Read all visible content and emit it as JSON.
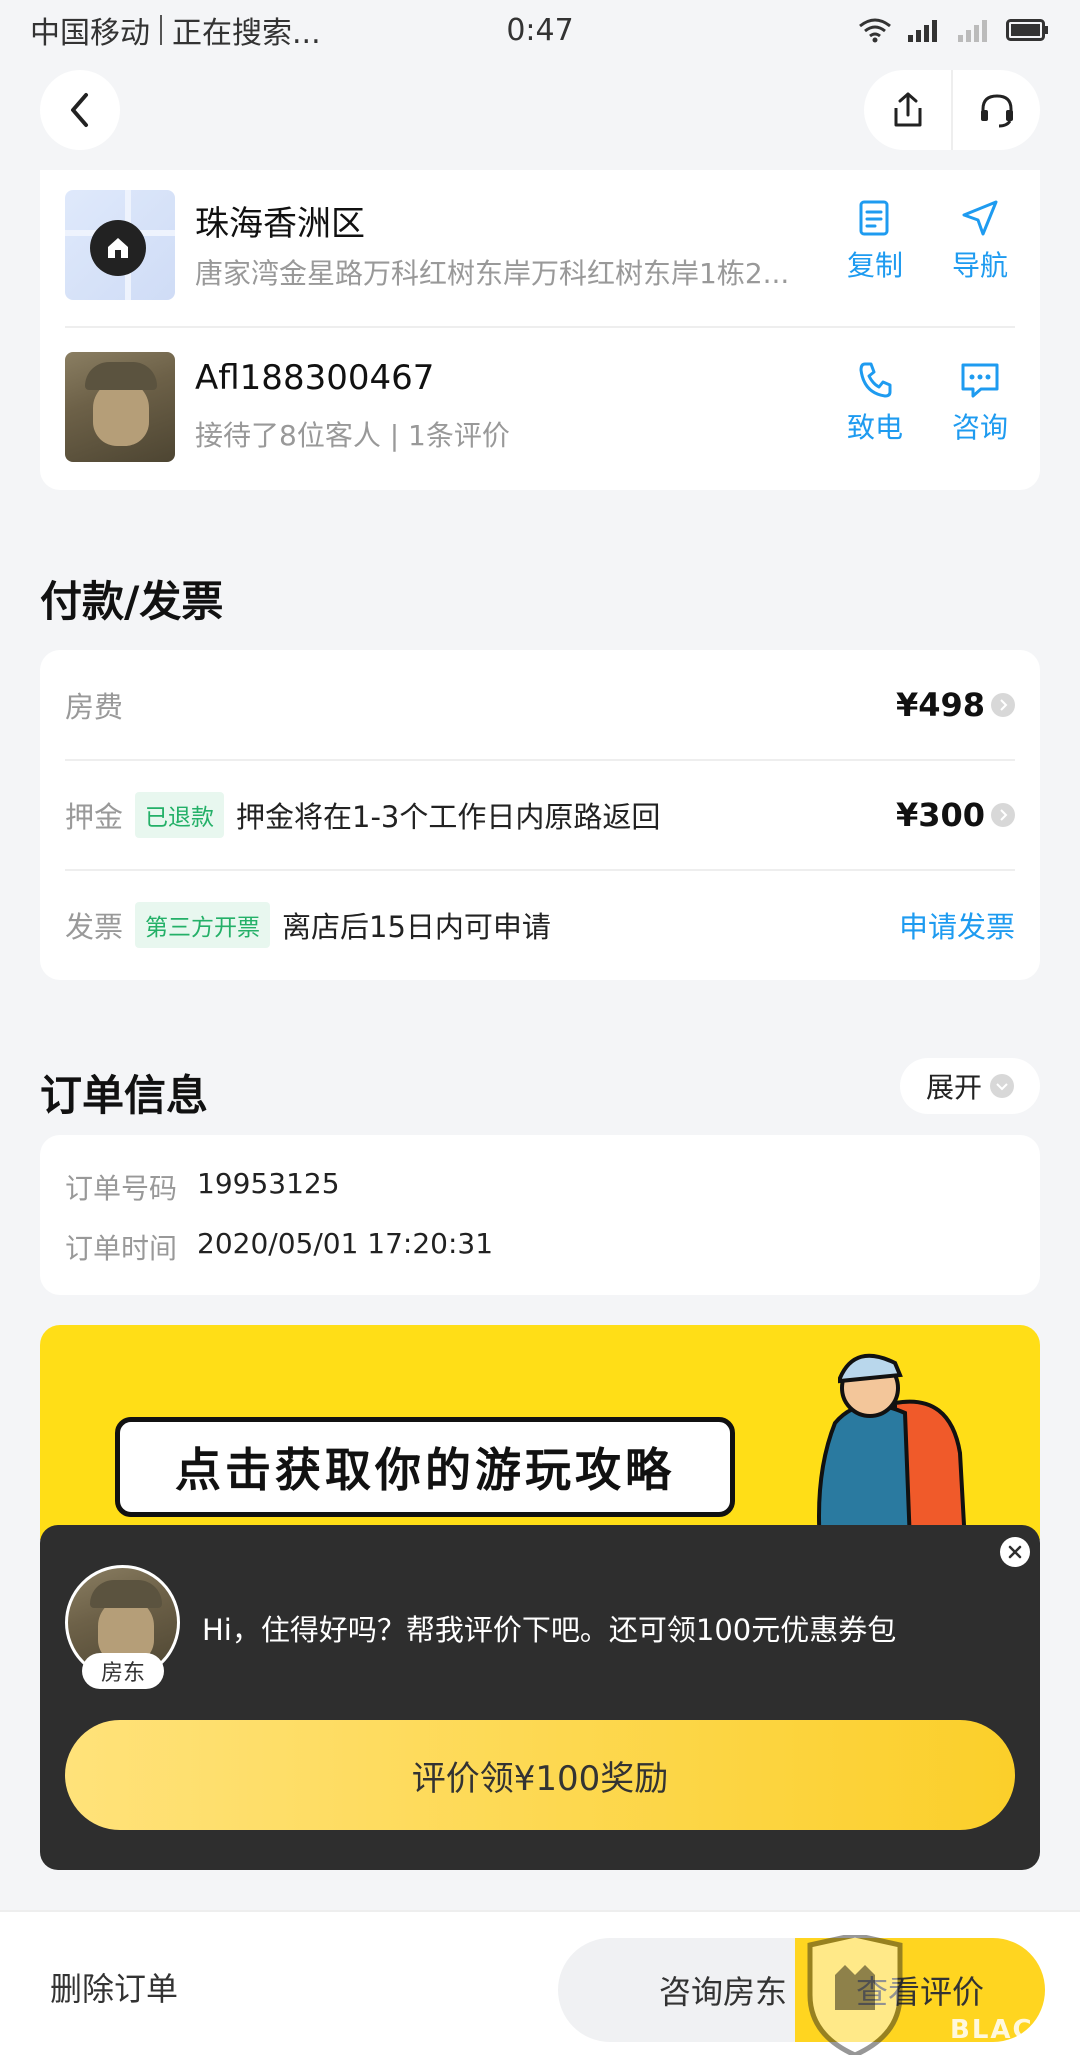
{
  "status_bar": {
    "carrier": "中国移动",
    "activity": "正在搜索...",
    "time": "0:47"
  },
  "location": {
    "title": "珠海香洲区",
    "address": "唐家湾金星路万科红树东岸万科红树东岸1栋2...",
    "copy_label": "复制",
    "nav_label": "导航"
  },
  "host": {
    "name": "Afl188300467",
    "stats": "接待了8位客人 | 1条评价",
    "call_label": "致电",
    "consult_label": "咨询"
  },
  "payment": {
    "section_title": "付款/发票",
    "room_fee_label": "房费",
    "room_fee_amount": "¥498",
    "deposit_label": "押金",
    "deposit_tag": "已退款",
    "deposit_desc": "押金将在1-3个工作日内原路返回",
    "deposit_amount": "¥300",
    "invoice_label": "发票",
    "invoice_tag": "第三方开票",
    "invoice_desc": "离店后15日内可申请",
    "invoice_link": "申请发票"
  },
  "order": {
    "section_title": "订单信息",
    "expand_label": "展开",
    "number_label": "订单号码",
    "number_value": "19953125",
    "time_label": "订单时间",
    "time_value": "2020/05/01 17:20:31"
  },
  "banner": {
    "text": "点击获取你的游玩攻略"
  },
  "popup": {
    "badge": "房东",
    "message": "Hi，住得好吗？帮我评价下吧。还可领100元优惠券包",
    "cta": "评价领¥100奖励"
  },
  "bottom_bar": {
    "delete_label": "删除订单",
    "consult_label": "咨询房东",
    "review_label": "查看评价"
  },
  "watermark": {
    "text": "BLACK CAT"
  },
  "colors": {
    "accent_blue": "#1e9bf0",
    "tag_green": "#24b068",
    "banner_yellow": "#ffde17",
    "cta_yellow": "#fbcf2a",
    "popup_bg": "#2e2e2e"
  }
}
